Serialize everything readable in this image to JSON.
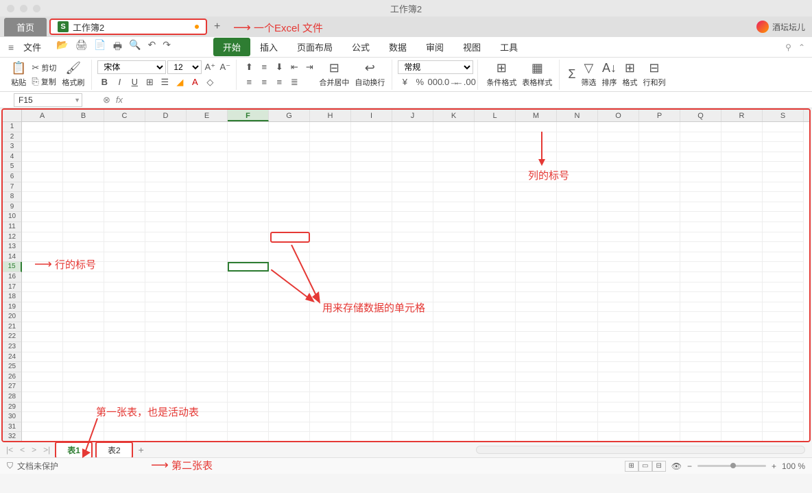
{
  "window": {
    "title": "工作簿2"
  },
  "tabs": {
    "home": "首页",
    "file_name": "工作簿2",
    "file_icon_letter": "S"
  },
  "user": {
    "name": "酒坛坛儿"
  },
  "menubar": {
    "file": "文件",
    "tabs": [
      "开始",
      "插入",
      "页面布局",
      "公式",
      "数据",
      "审阅",
      "视图",
      "工具"
    ]
  },
  "ribbon": {
    "paste": "粘贴",
    "cut": "剪切",
    "copy": "复制",
    "format_painter": "格式刷",
    "font_name": "宋体",
    "font_size": "12",
    "merge": "合并居中",
    "wrap": "自动换行",
    "number_format": "常规",
    "cond_format": "条件格式",
    "table_style": "表格样式",
    "filter": "筛选",
    "sort": "排序",
    "format": "格式",
    "rowcol": "行和列"
  },
  "namebox": {
    "value": "F15"
  },
  "columns": [
    "A",
    "B",
    "C",
    "D",
    "E",
    "F",
    "G",
    "H",
    "I",
    "J",
    "K",
    "L",
    "M",
    "N",
    "O",
    "P",
    "Q",
    "R",
    "S"
  ],
  "rows": [
    "1",
    "2",
    "3",
    "4",
    "5",
    "6",
    "7",
    "8",
    "9",
    "10",
    "11",
    "12",
    "13",
    "14",
    "15",
    "16",
    "17",
    "18",
    "19",
    "20",
    "21",
    "22",
    "23",
    "24",
    "25",
    "26",
    "27",
    "28",
    "29",
    "30",
    "31",
    "32"
  ],
  "active": {
    "col": "F",
    "row": "15"
  },
  "sheets": {
    "tab1": "表1",
    "tab2": "表2"
  },
  "status": {
    "protect": "文档未保护",
    "zoom": "100 %"
  },
  "annotations": {
    "excel_file": "一个Excel 文件",
    "col_label": "列的标号",
    "row_label": "行的标号",
    "cell_desc": "用来存储数据的单元格",
    "sheet1_desc": "第一张表，也是活动表",
    "sheet2_desc": "第二张表"
  }
}
